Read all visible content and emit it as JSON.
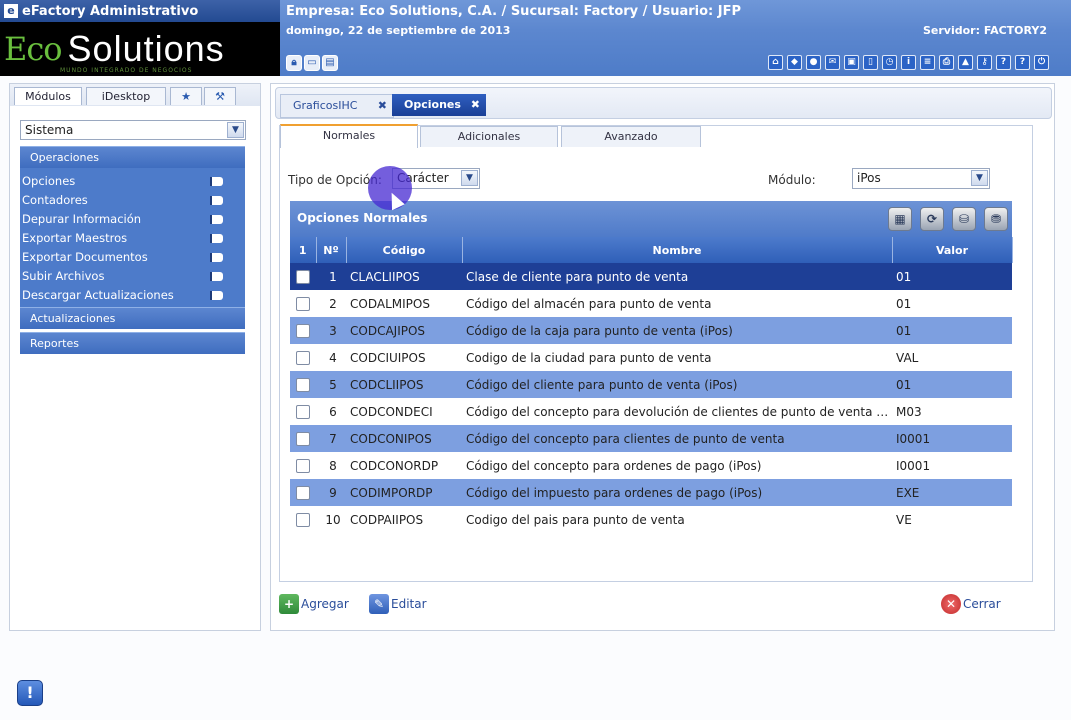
{
  "app": {
    "title": "eFactory Administrativo",
    "logo": {
      "eco": "Eco",
      "solutions": "Solutions",
      "tagline": "MUNDO INTEGRADO DE NEGOCIOS"
    }
  },
  "header": {
    "company_info": "Empresa: Eco Solutions, C.A. / Sucursal: Factory / Usuario: JFP",
    "date": "domingo, 22 de septiembre de 2013",
    "server": "Servidor: FACTORY2",
    "left_icons": [
      "lock-icon",
      "window-icon",
      "chart-icon"
    ],
    "right_icons": [
      "home-icon",
      "shield-icon",
      "chat-icon",
      "mail-icon",
      "monitor-icon",
      "document-icon",
      "clock-icon",
      "info-icon",
      "list-icon",
      "print-icon",
      "lock-icon",
      "key-icon",
      "help-icon",
      "question-icon",
      "exit-icon"
    ]
  },
  "sidebar": {
    "tabs": [
      {
        "label": "Módulos"
      },
      {
        "label": "iDesktop"
      },
      {
        "icon": "star-icon"
      },
      {
        "icon": "wrench-icon"
      }
    ],
    "module_select": {
      "value": "Sistema"
    },
    "sections": [
      {
        "title": "Operaciones",
        "items": [
          {
            "label": "Opciones"
          },
          {
            "label": "Contadores"
          },
          {
            "label": "Depurar Información"
          },
          {
            "label": "Exportar Maestros"
          },
          {
            "label": "Exportar Documentos"
          },
          {
            "label": "Subir Archivos"
          },
          {
            "label": "Descargar Actualizaciones"
          }
        ]
      },
      {
        "title": "Actualizaciones"
      },
      {
        "title": "Reportes"
      }
    ]
  },
  "main": {
    "tabs": [
      {
        "label": "GraficosIHC",
        "close": "✖"
      },
      {
        "label": "Opciones",
        "close": "✖"
      }
    ],
    "subtabs": [
      {
        "label": "Normales"
      },
      {
        "label": "Adicionales"
      },
      {
        "label": "Avanzado"
      }
    ],
    "filters": {
      "tipo_label": "Tipo de Opción:",
      "tipo_value": "Carácter",
      "modulo_label": "Módulo:",
      "modulo_value": "iPos"
    },
    "grid": {
      "title": "Opciones Normales",
      "columns": {
        "check": "1",
        "num": "Nº",
        "codigo": "Código",
        "nombre": "Nombre",
        "valor": "Valor"
      },
      "rows": [
        {
          "num": "1",
          "codigo": "CLACLIIPOS",
          "nombre": "Clase de cliente para punto de venta",
          "valor": "01"
        },
        {
          "num": "2",
          "codigo": "CODALMIPOS",
          "nombre": "Código del almacén para punto de venta",
          "valor": "01"
        },
        {
          "num": "3",
          "codigo": "CODCAJIPOS",
          "nombre": "Código de la caja para punto de venta (iPos)",
          "valor": "01"
        },
        {
          "num": "4",
          "codigo": "CODCIUIPOS",
          "nombre": "Codigo de la ciudad para punto de venta",
          "valor": "VAL"
        },
        {
          "num": "5",
          "codigo": "CODCLIIPOS",
          "nombre": "Código del cliente para punto de venta (iPos)",
          "valor": "01"
        },
        {
          "num": "6",
          "codigo": "CODCONDECI",
          "nombre": "Código del concepto para devolución de clientes de punto de venta (iPos)",
          "valor": "M03"
        },
        {
          "num": "7",
          "codigo": "CODCONIPOS",
          "nombre": "Código del concepto para clientes de punto de venta",
          "valor": "I0001"
        },
        {
          "num": "8",
          "codigo": "CODCONORDP",
          "nombre": "Código del concepto para ordenes de pago (iPos)",
          "valor": "I0001"
        },
        {
          "num": "9",
          "codigo": "CODIMPORDP",
          "nombre": "Código del impuesto para ordenes de pago (iPos)",
          "valor": "EXE"
        },
        {
          "num": "10",
          "codigo": "CODPAIIPOS",
          "nombre": "Codigo del pais para punto de venta",
          "valor": "VE"
        }
      ],
      "tools": [
        "grid-layout-icon",
        "refresh-icon",
        "database-icon",
        "database-export-icon"
      ]
    },
    "actions": {
      "add_label": "Agregar",
      "edit_label": "Editar",
      "close_label": "Cerrar"
    }
  },
  "colors": {
    "accent": "#4d7bca",
    "selected_row": "#1e3f96",
    "alt_row": "#7d9fe0"
  }
}
